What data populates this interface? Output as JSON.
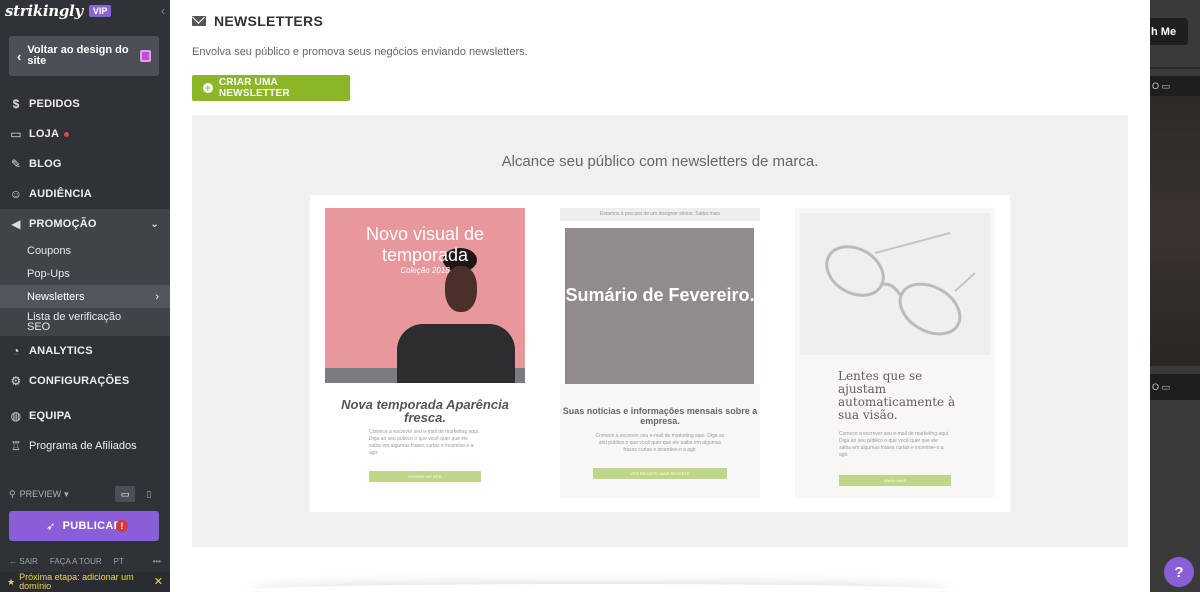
{
  "sidebar": {
    "logo": "strikingly",
    "vip_badge": "VIP",
    "collapse_icon": "‹",
    "back_label": "Voltar ao design do site",
    "nav": [
      {
        "label": "PEDIDOS",
        "icon": "dollar-icon"
      },
      {
        "label": "LOJA",
        "icon": "store-icon"
      },
      {
        "label": "BLOG",
        "icon": "pen-icon"
      },
      {
        "label": "AUDIÊNCIA",
        "icon": "user-icon"
      },
      {
        "label": "PROMOÇÃO",
        "icon": "megaphone-icon"
      }
    ],
    "sub": [
      {
        "label": "Coupons"
      },
      {
        "label": "Pop-Ups"
      },
      {
        "label": "Newsletters"
      },
      {
        "label": "Lista de verificação SEO"
      }
    ],
    "nav_bottom": [
      {
        "label": "ANALYTICS",
        "icon": "chart-icon"
      },
      {
        "label": "CONFIGURAÇÕES",
        "icon": "gear-icon"
      },
      {
        "label": "EQUIPA",
        "icon": "team-icon"
      },
      {
        "label": "Programa de Afiliados",
        "icon": "trophy-icon"
      }
    ],
    "preview": "PREVIEW",
    "publish": "PUBLICAR",
    "publish_warning": "!",
    "footer": {
      "exit": "SAIR",
      "tour": "FAÇA A TOUR",
      "lang": "PT",
      "more": "•••"
    },
    "next_step": "Próxima etapa: adicionar um domínio"
  },
  "main": {
    "title": "NEWSLETTERS",
    "description": "Envolva seu público e promova seus negócios enviando newsletters.",
    "create_button": "CRIAR UMA NEWSLETTER",
    "promo_headline": "Alcance seu público com newsletters de marca."
  },
  "cards": [
    {
      "image_title": "Novo visual de temporada",
      "image_subtitle": "Coleção 2018",
      "heading": "Nova temporada Aparência fresca.",
      "body": "Comece a escrever seu e-mail de marketing aqui. Diga ao seu público o que você quer que ele saiba em algumas frases curtas e incentive-o a agir.",
      "button": "ENTRAR NO SITE"
    },
    {
      "top_bar": "Estamos à procura de um designer sênior. Saiba mais",
      "image_title": "Sumário de Fevereiro.",
      "heading": "Suas notícias e informações mensais sobre a empresa.",
      "body": "Comece a escrever seu e-mail de marketing aqui. Diga ao seu público o que você quer que ele saiba em algumas frases curtas e incentive-o a agir.",
      "button": "VER PROJETO MAIS RECENTE"
    },
    {
      "heading": "Lentes que se ajustam automaticamente à sua visão.",
      "body": "Comece a escrever seu e-mail de marketing aqui. Diga ao seu público o que você quer que ele saiba em algumas frases curtas e incentive-o a agir.",
      "button": "SAIBA MAIS"
    }
  ],
  "background": {
    "button_fragment": "h Me",
    "strip1": "O",
    "strip2": "O"
  },
  "help": "?",
  "colors": {
    "accent_green": "#8bb628",
    "accent_purple": "#8a5ed6",
    "sidebar": "#2f3337"
  }
}
